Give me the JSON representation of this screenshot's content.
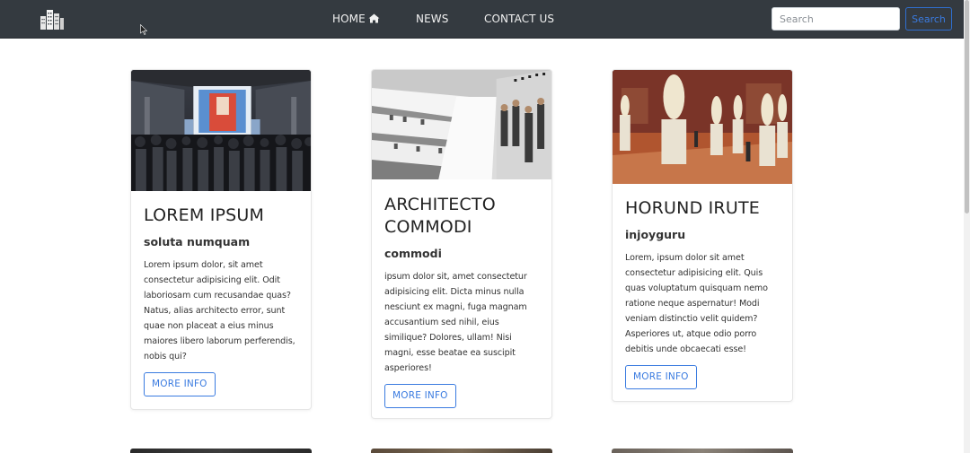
{
  "navbar": {
    "logo_icon": "buildings-icon",
    "links": [
      {
        "label": "HOME",
        "icon": "home-icon"
      },
      {
        "label": "NEWS"
      },
      {
        "label": "CONTACT US"
      }
    ],
    "search": {
      "placeholder": "Search",
      "value": "",
      "button_label": "Search"
    },
    "colors": {
      "background": "#343a40",
      "accent": "#3a7be0"
    }
  },
  "cards": [
    {
      "image": "museum-crowd-photo",
      "title": "LOREM IPSUM",
      "subtitle": "soluta numquam",
      "text": "Lorem ipsum dolor, sit amet consectetur adipisicing elit. Odit laboriosam cum recusandae quas? Natus, alias architecto error, sunt quae non placeat a eius minus maiores libero laborum perferendis, nobis qui?",
      "button_label": "MORE INFO"
    },
    {
      "image": "spiral-gallery-photo",
      "title": "ARCHITECTO COMMODI",
      "subtitle": "commodi",
      "text": "ipsum dolor sit, amet consectetur adipisicing elit. Dicta minus nulla nesciunt ex magni, fuga magnam accusantium sed nihil, eius similique? Dolores, ullam! Nisi magni, esse beatae ea suscipit asperiores!",
      "button_label": "MORE INFO"
    },
    {
      "image": "sculpture-hall-photo",
      "title": "HORUND IRUTE",
      "subtitle": "injoyguru",
      "text": "Lorem, ipsum dolor sit amet consectetur adipisicing elit. Quis quas voluptatum quisquam nemo ratione neque aspernatur! Modi veniam distinctio velit quidem? Asperiores ut, atque odio porro debitis unde obcaecati esse!",
      "button_label": "MORE INFO"
    }
  ]
}
